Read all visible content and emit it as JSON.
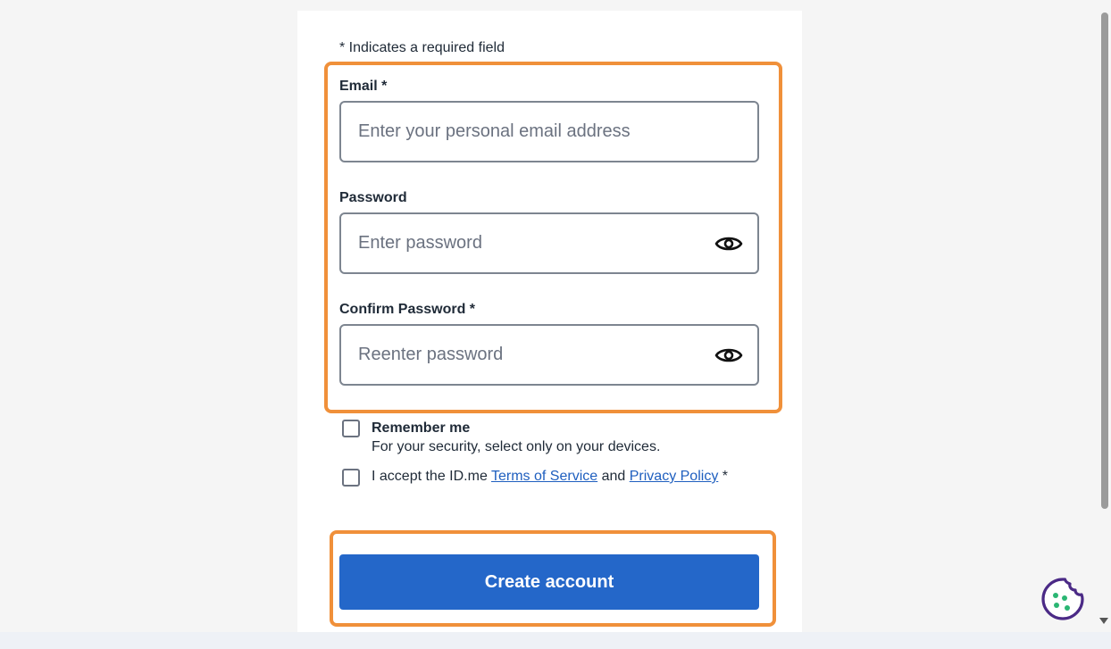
{
  "form": {
    "required_note": "* Indicates a required field",
    "email": {
      "label": "Email *",
      "placeholder": "Enter your personal email address",
      "value": ""
    },
    "password": {
      "label": "Password",
      "placeholder": "Enter password",
      "value": ""
    },
    "confirm_password": {
      "label": "Confirm Password *",
      "placeholder": "Reenter password",
      "value": ""
    },
    "remember_me": {
      "title": "Remember me",
      "description": "For your security, select only on your devices.",
      "checked": false
    },
    "terms": {
      "prefix": "I accept the ID.me ",
      "terms_link": "Terms of Service",
      "middle": " and ",
      "privacy_link": "Privacy Policy",
      "suffix": " *",
      "checked": false
    },
    "submit_label": "Create account"
  },
  "icons": {
    "eye": "eye-icon",
    "cookie": "cookie-icon"
  },
  "colors": {
    "highlight": "#f0903a",
    "primary_button": "#2467c9",
    "link": "#1f5fbf",
    "cookie_icon": "#4b2a86",
    "cookie_dots": "#2bb673"
  }
}
